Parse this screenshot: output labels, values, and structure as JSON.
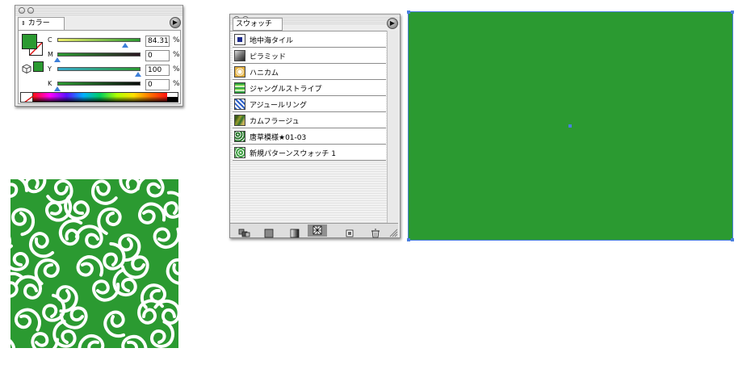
{
  "color_panel": {
    "tab_label": "カラー",
    "menu_icon": "play-right-icon",
    "fill_color": "#2b9a31",
    "channels": [
      {
        "name": "C",
        "value": "84.31",
        "unit": "%",
        "level": 0.8431,
        "track_from": "#ecec6a",
        "track_to": "#2b9a31"
      },
      {
        "name": "M",
        "value": "0",
        "unit": "%",
        "level": 0.0,
        "track_from": "#2b9a31",
        "track_to": "#2a1420"
      },
      {
        "name": "Y",
        "value": "100",
        "unit": "%",
        "level": 1.0,
        "track_from": "#36aacd",
        "track_to": "#2b9a31"
      },
      {
        "name": "K",
        "value": "0",
        "unit": "%",
        "level": 0.0,
        "track_from": "#2b9a31",
        "track_to": "#0a0a0a"
      }
    ]
  },
  "swatch_panel": {
    "tab_label": "スウォッチ",
    "menu_icon": "play-right-icon",
    "items": [
      {
        "label": "地中海タイル",
        "icon": "tile-swatch-icon"
      },
      {
        "label": "ピラミッド",
        "icon": "pyramid-swatch-icon"
      },
      {
        "label": "ハニカム",
        "icon": "honeycomb-swatch-icon"
      },
      {
        "label": "ジャングルストライプ",
        "icon": "stripe-swatch-icon"
      },
      {
        "label": "アジュールリング",
        "icon": "ring-swatch-icon"
      },
      {
        "label": "カムフラージュ",
        "icon": "camouflage-swatch-icon"
      },
      {
        "label": "唐草模様★01-03",
        "icon": "karakusa-swatch-icon"
      },
      {
        "label": "新規パターンスウォッチ 1",
        "icon": "new-pattern-swatch-icon"
      }
    ],
    "toolbar": [
      "show-all-swatches-icon",
      "show-color-swatches-icon",
      "show-gradient-swatches-icon",
      "show-pattern-swatches-icon",
      "new-swatch-icon",
      "trash-icon"
    ]
  },
  "canvas": {
    "rect_color": "#2b9a31",
    "selection_color": "#4a7fe0"
  },
  "pattern_preview": {
    "background": "#2b9a31",
    "curl_color": "#ffffff"
  }
}
